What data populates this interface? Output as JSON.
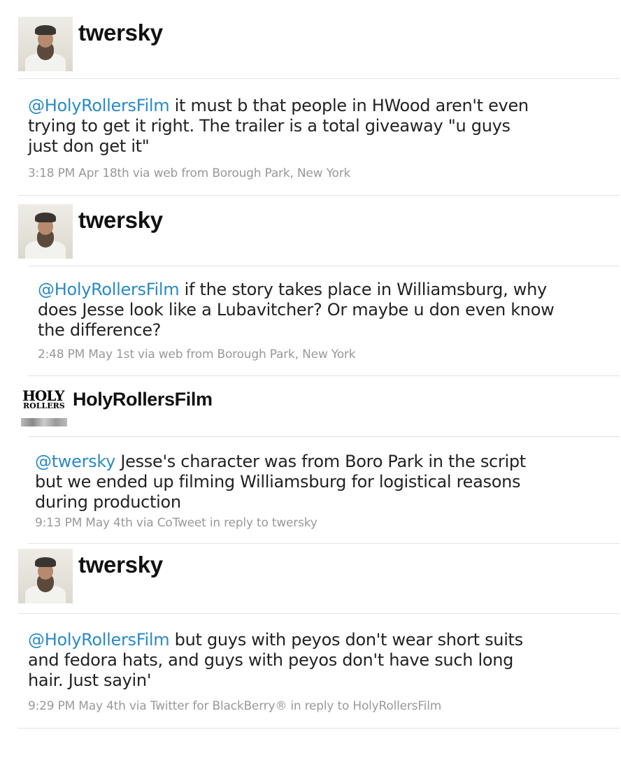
{
  "tweets": [
    {
      "username": "twersky",
      "avatar_icon": "user-avatar-icon",
      "mention": "@HolyRollersFilm",
      "text_lines": [
        " it must b that people in HWood aren't even",
        "trying to get it right. The trailer is a total giveaway \"u guys",
        "just don get it\""
      ],
      "meta": "3:18 PM Apr 18th via web from Borough Park, New York"
    },
    {
      "username": "twersky",
      "avatar_icon": "user-avatar-icon",
      "mention": "@HolyRollersFilm",
      "text_lines": [
        " if the story takes place in Williamsburg, why",
        "does Jesse look like a Lubavitcher? Or maybe u don even know",
        "the difference?"
      ],
      "meta": "2:48 PM May 1st via web from Borough Park, New York"
    },
    {
      "username": "HolyRollersFilm",
      "avatar_icon": "holy-rollers-logo-icon",
      "logo_text_1": "HOLY",
      "logo_text_2": "ROLLERS",
      "mention": "@twersky",
      "text_lines": [
        " Jesse's character was from Boro Park in the script",
        "but we ended up filming Williamsburg for logistical reasons",
        "during production"
      ],
      "meta": "9:13 PM May 4th via CoTweet in reply to twersky"
    },
    {
      "username": "twersky",
      "avatar_icon": "user-avatar-icon",
      "mention": "@HolyRollersFilm",
      "text_lines": [
        " but guys with peyos don't wear short suits",
        "and fedora hats, and guys with peyos don't have such long",
        "hair. Just sayin'"
      ],
      "meta": "9:29 PM May 4th via Twitter for BlackBerry® in reply to HolyRollersFilm"
    }
  ],
  "colors": {
    "mention": "#2a8ac4",
    "meta": "#999999",
    "divider": "#e3e3e3"
  }
}
